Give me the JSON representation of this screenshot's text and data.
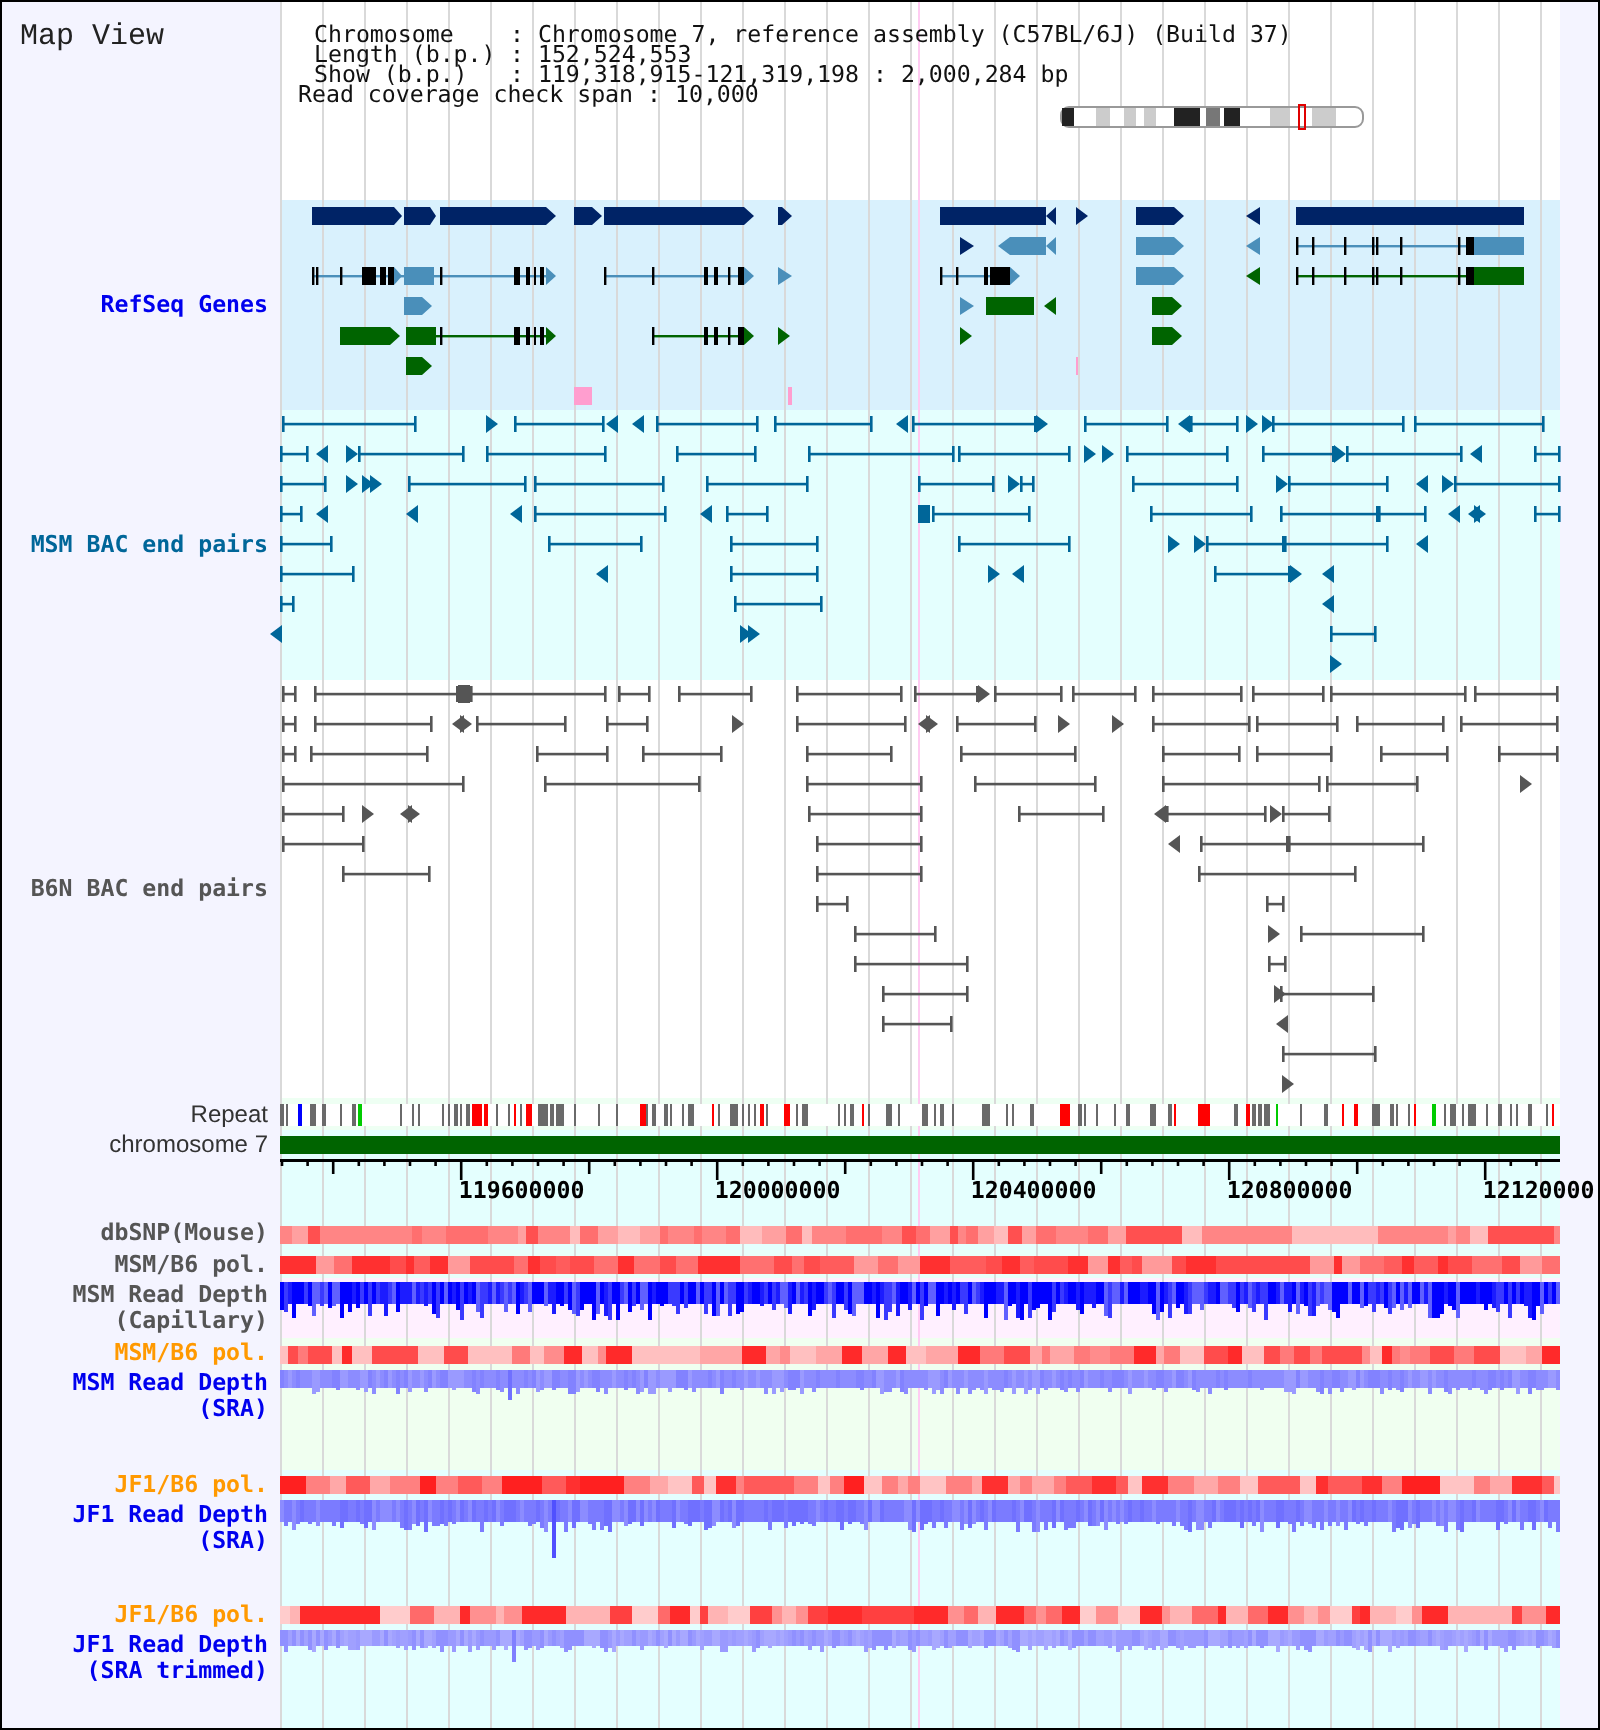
{
  "title": "Map View",
  "info": {
    "rows": [
      {
        "label": "Chromosome",
        "value": ": Chromosome 7, reference assembly (C57BL/6J) (Build 37)"
      },
      {
        "label": "Length (b.p.)",
        "value": ": 152,524,553"
      },
      {
        "label": "Show (b.p.)",
        "value": ": 119,318,915-121,319,198 : 2,000,284 bp"
      }
    ],
    "span": {
      "label": "Read coverage check span",
      "value": ": 10,000"
    }
  },
  "tracks": [
    {
      "kind": "genes",
      "label": "RefSeq Genes",
      "color": "#0000ee"
    },
    {
      "kind": "bacpairs",
      "label": "MSM BAC end pairs",
      "color": "#006699"
    },
    {
      "kind": "bacpairs",
      "label": "B6N BAC end pairs",
      "color": "#555555"
    },
    {
      "kind": "repeats",
      "label": "Repeat",
      "color": "#333333"
    },
    {
      "kind": "chromosome",
      "label": "chromosome 7",
      "color": "#333333"
    },
    {
      "kind": "axis",
      "ticks": [
        "119600000",
        "120000000",
        "120400000",
        "120800000",
        "12120000"
      ]
    },
    {
      "kind": "heatmap",
      "label": "dbSNP(Mouse)",
      "color": "#555555"
    },
    {
      "kind": "heatmap",
      "label": "MSM/B6 pol.",
      "color": "#555555"
    },
    {
      "kind": "depth",
      "label": "MSM Read Depth (Capillary)",
      "color": "#555555"
    },
    {
      "kind": "heatmap",
      "label": "MSM/B6 pol.",
      "color": "#ff9900"
    },
    {
      "kind": "depth",
      "label": "MSM Read Depth (SRA)",
      "color": "#0000ee"
    },
    {
      "kind": "heatmap",
      "label": "JF1/B6 pol.",
      "color": "#ff9900"
    },
    {
      "kind": "depth",
      "label": "JF1 Read Depth (SRA)",
      "color": "#0000ee"
    },
    {
      "kind": "heatmap",
      "label": "JF1/B6 pol.",
      "color": "#ff9900"
    },
    {
      "kind": "depth",
      "label": "JF1 Read Depth (SRA trimmed)",
      "color": "#0000ee"
    }
  ]
}
